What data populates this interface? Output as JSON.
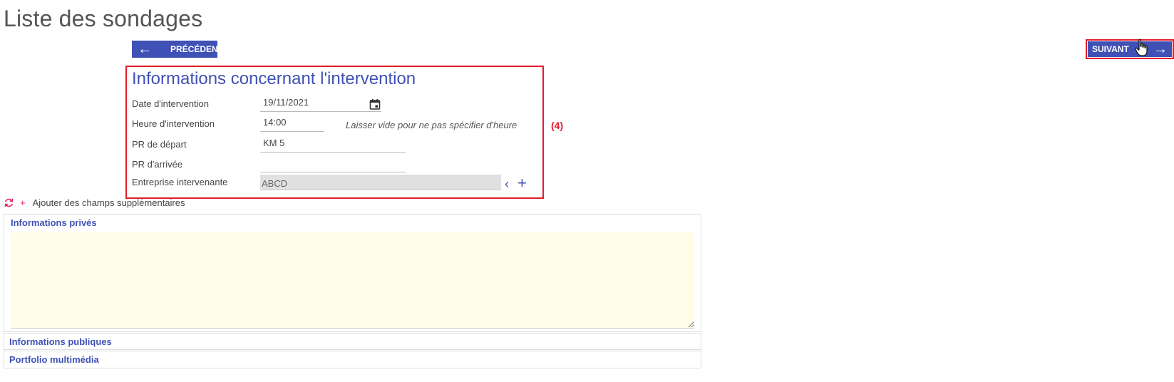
{
  "page": {
    "title": "Liste des sondages"
  },
  "nav": {
    "prev_label": "PRÉCÉDENT",
    "next_label": "SUIVANT",
    "prev_arrow": "←",
    "next_arrow": "→"
  },
  "form": {
    "title": "Informations concernant l'intervention",
    "fields": [
      {
        "label": "Date d'intervention",
        "value": "19/11/2021",
        "icon": "calendar-icon"
      },
      {
        "label": "Heure d'intervention",
        "value": "14:00",
        "hint": "Laisser vide pour ne pas spécifier d'heure"
      },
      {
        "label": "PR de départ",
        "value": "KM 5"
      },
      {
        "label": "PR d'arrivée",
        "value": ""
      },
      {
        "label": "Entreprise intervenante",
        "value": "ABCD",
        "disabled": true
      }
    ],
    "step_marker": "(4)",
    "chevron_glyph": "‹",
    "plus_glyph": "+"
  },
  "extra": {
    "plus": "+",
    "label": "Ajouter des champs supplémentaires"
  },
  "panels": {
    "private": {
      "title": "Informations privés",
      "value": ""
    },
    "public": {
      "title": "Informations publiques"
    },
    "portfolio": {
      "title": "Portfolio multimédia"
    }
  },
  "colors": {
    "primary": "#3f51b5",
    "highlight": "#e21c2b",
    "textarea_bg": "#fffde7",
    "disabled_bg": "#e0e0e0",
    "accent_pink": "#e91e63"
  }
}
